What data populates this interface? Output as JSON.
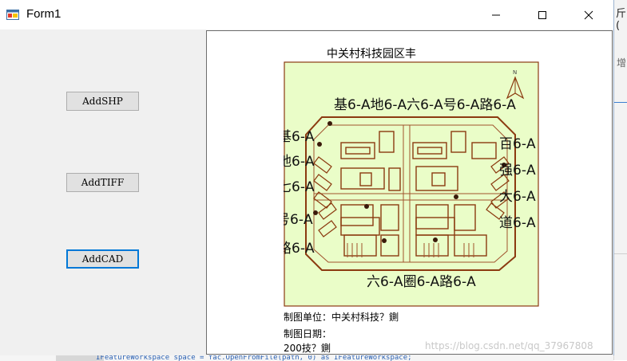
{
  "window": {
    "title": "Form1",
    "controls": {
      "minimize": "minimize",
      "maximize": "maximize",
      "close": "close"
    }
  },
  "buttons": [
    {
      "label": "AddSHP"
    },
    {
      "label": "AddTIFF"
    },
    {
      "label": "AddCAD"
    }
  ],
  "map": {
    "title": "中关村科技园区丰",
    "labels": {
      "top_row": "基6-A地6-A六6-A号6-A路6-A",
      "left_1": "基6-A",
      "left_2": "地6-A",
      "left_3": "七6-A",
      "left_4": "号6-A",
      "left_5": "路6-A",
      "right_1": "百6-A",
      "right_2": "强6-A",
      "right_3": "大6-A",
      "right_4": "道6-A",
      "bottom": "六6-A圈6-A路6-A",
      "north": "N"
    },
    "footer_unit": "制图单位：中关村科技？鍘",
    "footer_date": "制图日期：",
    "footer_year": "200技？鍘"
  },
  "background": {
    "right_text_1": "斤(",
    "right_text_2": "增",
    "editor_code": "IFeatureWorkspace space = fac.OpenFromFile(path, 0) as IFeatureWorkspace;"
  },
  "watermark": "https://blog.csdn.net/qq_37967808",
  "colors": {
    "map_fill": "#eafdc8",
    "map_border": "#8b3a10",
    "focus_blue": "#0078d7"
  }
}
